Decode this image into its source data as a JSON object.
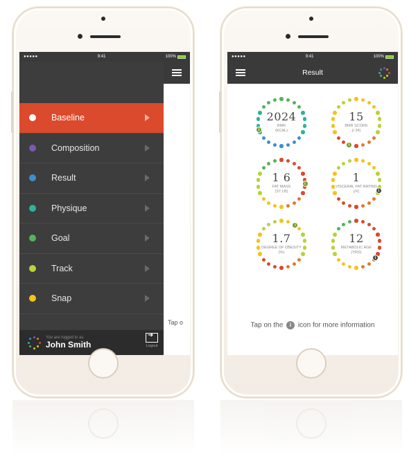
{
  "left_phone": {
    "status": {
      "signal": "●●●●● ",
      "time": "9:41",
      "battery": "100%"
    },
    "menu": [
      {
        "label": "Baseline",
        "color": "#ffffff",
        "active": true
      },
      {
        "label": "Composition",
        "color": "#7b57b6"
      },
      {
        "label": "Result",
        "color": "#3b8fd0"
      },
      {
        "label": "Physique",
        "color": "#2cb39a"
      },
      {
        "label": "Goal",
        "color": "#56b35a"
      },
      {
        "label": "Track",
        "color": "#b7d33a"
      },
      {
        "label": "Snap",
        "color": "#f5c21b"
      }
    ],
    "footer": {
      "logged_label": "You are logged in as",
      "user_name": "John Smith",
      "logout_label": "Logout"
    },
    "peek_text": "Tap o"
  },
  "right_phone": {
    "status": {
      "signal": "●●●●● ",
      "time": "9:41",
      "battery": "100%"
    },
    "title": "Result",
    "gauges": [
      {
        "value": "2024",
        "label": "BMR",
        "unit": "(kcal)",
        "level": 0.7,
        "scheme": "cool",
        "info": "green"
      },
      {
        "value": "15",
        "label": "BMR SCORE",
        "unit": "(/ 24)",
        "level": 0.55,
        "scheme": "warm",
        "info": "green"
      },
      {
        "value": "1 6",
        "label": "FAT MASS",
        "unit": "(st lb)",
        "level": 0.25,
        "scheme": "red",
        "info": "green"
      },
      {
        "value": "1",
        "label": "VISCERAL FAT RATING",
        "unit": "(/x)",
        "level": 0.3,
        "scheme": "warm",
        "info": "dark"
      },
      {
        "value": "1.7",
        "label": "DEGREE OF OBESITY",
        "unit": "(%)",
        "level": 0.1,
        "scheme": "warm",
        "info": "green"
      },
      {
        "value": "12",
        "label": "METABOLIC AGE",
        "unit": "(yrs)",
        "level": 0.35,
        "scheme": "red",
        "info": "dark"
      }
    ],
    "hint": {
      "before": "Tap on the",
      "icon": "i",
      "after": "icon for more information"
    }
  },
  "colors": {
    "active_bg": "#db4a2c",
    "menu_bg": "#3d3d3d",
    "header_bg": "#3a3a3a"
  }
}
